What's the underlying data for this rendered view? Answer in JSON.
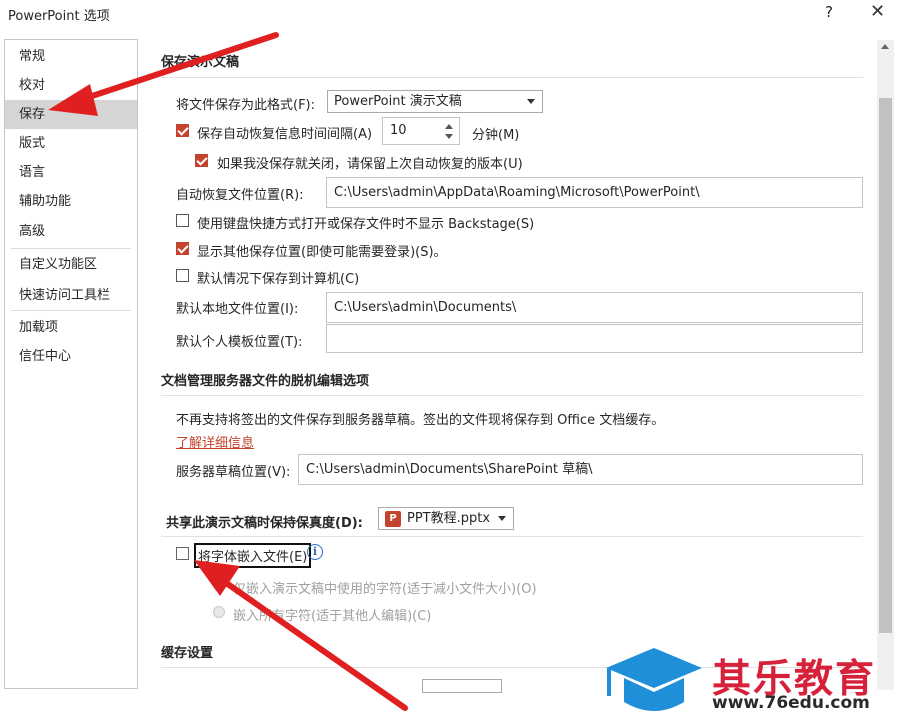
{
  "window": {
    "title": "PowerPoint 选项",
    "help": "?",
    "close": "✕"
  },
  "nav": {
    "items": [
      "常规",
      "校对",
      "保存",
      "版式",
      "语言",
      "辅助功能",
      "高级",
      "自定义功能区",
      "快速访问工具栏",
      "加载项",
      "信任中心"
    ],
    "selected": "保存"
  },
  "save_section": {
    "heading": "保存演示文稿",
    "format_label": "将文件保存为此格式(F):",
    "format_value": "PowerPoint 演示文稿",
    "autorecover_label": "保存自动恢复信息时间间隔(A)",
    "autorecover_checked": true,
    "autorecover_minutes": "10",
    "minutes_label": "分钟(M)",
    "keep_last_label": "如果我没保存就关闭，请保留上次自动恢复的版本(U)",
    "keep_last_checked": true,
    "autorecover_location_label": "自动恢复文件位置(R):",
    "autorecover_location_value": "C:\\Users\\admin\\AppData\\Roaming\\Microsoft\\PowerPoint\\",
    "no_backstage_label": "使用键盘快捷方式打开或保存文件时不显示 Backstage(S)",
    "no_backstage_checked": false,
    "show_other_label": "显示其他保存位置(即使可能需要登录)(S)。",
    "show_other_checked": true,
    "save_to_computer_label": "默认情况下保存到计算机(C)",
    "save_to_computer_checked": false,
    "local_location_label": "默认本地文件位置(I):",
    "local_location_value": "C:\\Users\\admin\\Documents\\",
    "template_location_label": "默认个人模板位置(T):",
    "template_location_value": ""
  },
  "offline_section": {
    "heading": "文档管理服务器文件的脱机编辑选项",
    "description": "不再支持将签出的文件保存到服务器草稿。签出的文件现将保存到 Office 文档缓存。",
    "learn_more": "了解详细信息",
    "drafts_label": "服务器草稿位置(V):",
    "drafts_value": "C:\\Users\\admin\\Documents\\SharePoint 草稿\\"
  },
  "fidelity_section": {
    "heading": "共享此演示文稿时保持保真度(D):",
    "file_value": "PPT教程.pptx",
    "file_icon": "powerpoint-file-icon",
    "embed_label": "将字体嵌入文件(E)",
    "embed_checked": false,
    "embed_used_label": "仅嵌入演示文稿中使用的字符(适于减小文件大小)(O)",
    "embed_all_label": "嵌入所有字符(适于其他人编辑)(C)"
  },
  "cache_section": {
    "heading": "缓存设置"
  },
  "watermark": {
    "text": "其乐教育",
    "url": "www.76edu.com",
    "brand_color": "#d7213a",
    "icon_color": "#1e8fd8"
  },
  "colors": {
    "accent": "#c4432d",
    "annotation_arrow": "#e02020"
  }
}
